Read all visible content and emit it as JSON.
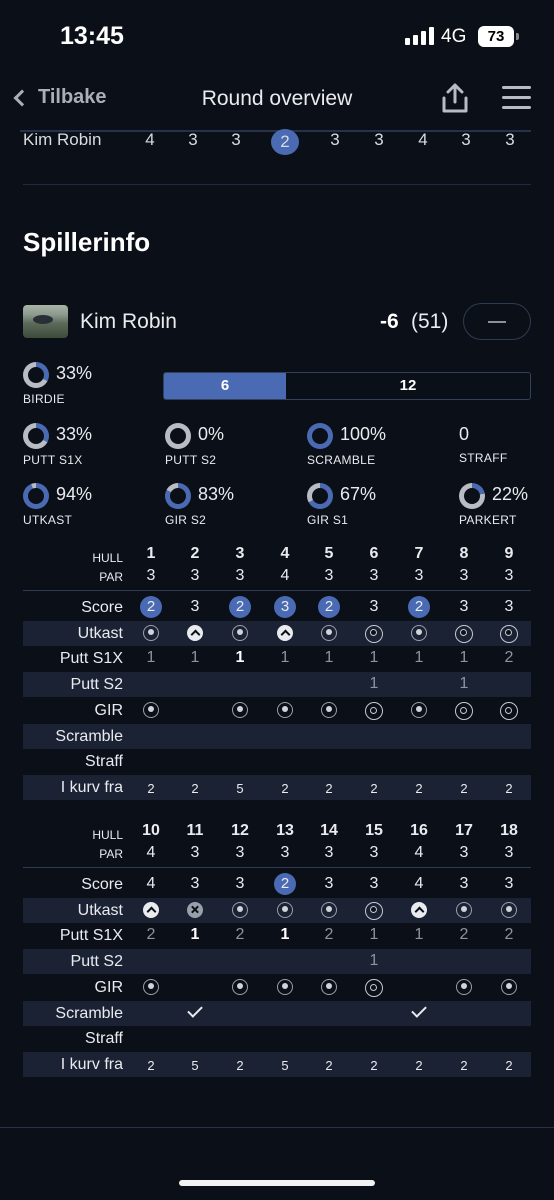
{
  "status": {
    "time": "13:45",
    "network": "4G",
    "battery": "73"
  },
  "nav": {
    "back_label": "Tilbake",
    "title": "Round overview"
  },
  "top_row": {
    "name": "Kim Robin",
    "scores": [
      "4",
      "3",
      "3",
      "2",
      "3",
      "3",
      "4",
      "3",
      "3"
    ],
    "highlight_index": 3
  },
  "section_title": "Spillerinfo",
  "player": {
    "name": "Kim Robin",
    "score": "-6",
    "total": "(51)"
  },
  "stats": [
    {
      "value": "33%",
      "label": "BIRDIE",
      "fraction": 0.33
    },
    {
      "value": "33%",
      "label": "PUTT S1X",
      "fraction": 0.33
    },
    {
      "value": "0%",
      "label": "PUTT S2",
      "fraction": 0
    },
    {
      "value": "100%",
      "label": "SCRAMBLE",
      "fraction": 1
    },
    {
      "value": "0",
      "label": "STRAFF"
    },
    {
      "value": "94%",
      "label": "UTKAST",
      "fraction": 0.94
    },
    {
      "value": "83%",
      "label": "GIR S2",
      "fraction": 0.83
    },
    {
      "value": "67%",
      "label": "GIR S1",
      "fraction": 0.67
    },
    {
      "value": "22%",
      "label": "PARKERT",
      "fraction": 0.22
    }
  ],
  "toggle": {
    "option_a": "6",
    "option_b": "12"
  },
  "row_labels": {
    "hull": "HULL",
    "par": "PAR",
    "score": "Score",
    "utkast": "Utkast",
    "putt_s1x": "Putt S1X",
    "putt_s2": "Putt S2",
    "gir": "GIR",
    "scramble": "Scramble",
    "straff": "Straff",
    "kurv": "I kurv fra"
  },
  "front": {
    "holes": [
      "1",
      "2",
      "3",
      "4",
      "5",
      "6",
      "7",
      "8",
      "9"
    ],
    "par": [
      "3",
      "3",
      "3",
      "4",
      "3",
      "3",
      "3",
      "3",
      "3"
    ],
    "score": [
      "2",
      "3",
      "2",
      "3",
      "2",
      "3",
      "2",
      "3",
      "3"
    ],
    "score_badge": [
      true,
      false,
      true,
      true,
      true,
      false,
      true,
      false,
      false
    ],
    "utkast": [
      "target",
      "up",
      "target",
      "up",
      "target",
      "targetL",
      "target",
      "targetL",
      "targetL"
    ],
    "putt_s1x": [
      "1",
      "1",
      "1",
      "1",
      "1",
      "1",
      "1",
      "1",
      "2"
    ],
    "putt_s1x_bold": [
      false,
      false,
      true,
      false,
      false,
      false,
      false,
      false,
      false
    ],
    "putt_s2": [
      "",
      "",
      "",
      "",
      "",
      "1",
      "",
      "1",
      ""
    ],
    "gir": [
      "target",
      "",
      "target",
      "target",
      "target",
      "targetL",
      "target",
      "targetL",
      "targetL"
    ],
    "scramble": [
      "",
      "",
      "",
      "",
      "",
      "",
      "",
      "",
      ""
    ],
    "straff": [
      "",
      "",
      "",
      "",
      "",
      "",
      "",
      "",
      ""
    ],
    "kurv": [
      "2",
      "2",
      "5",
      "2",
      "2",
      "2",
      "2",
      "2",
      "2"
    ]
  },
  "back": {
    "holes": [
      "10",
      "11",
      "12",
      "13",
      "14",
      "15",
      "16",
      "17",
      "18"
    ],
    "par": [
      "4",
      "3",
      "3",
      "3",
      "3",
      "3",
      "4",
      "3",
      "3"
    ],
    "score": [
      "4",
      "3",
      "3",
      "2",
      "3",
      "3",
      "4",
      "3",
      "3"
    ],
    "score_badge": [
      false,
      false,
      false,
      true,
      false,
      false,
      false,
      false,
      false
    ],
    "utkast": [
      "up",
      "x",
      "target",
      "target",
      "target",
      "targetL",
      "up",
      "target",
      "target"
    ],
    "putt_s1x": [
      "2",
      "1",
      "2",
      "1",
      "2",
      "1",
      "1",
      "2",
      "2"
    ],
    "putt_s1x_bold": [
      false,
      true,
      false,
      true,
      false,
      false,
      false,
      false,
      false
    ],
    "putt_s2": [
      "",
      "",
      "",
      "",
      "",
      "1",
      "",
      "",
      ""
    ],
    "gir": [
      "target",
      "",
      "target",
      "target",
      "target",
      "targetL",
      "",
      "target",
      "target"
    ],
    "scramble": [
      "",
      "check",
      "",
      "",
      "",
      "",
      "check",
      "",
      ""
    ],
    "straff": [
      "",
      "",
      "",
      "",
      "",
      "",
      "",
      "",
      ""
    ],
    "kurv": [
      "2",
      "5",
      "2",
      "5",
      "2",
      "2",
      "2",
      "2",
      "2"
    ]
  },
  "colors": {
    "background": "#0b0f17",
    "accent": "#4a6bb3",
    "row_shade": "#1a2233",
    "muted": "#8e949e"
  }
}
